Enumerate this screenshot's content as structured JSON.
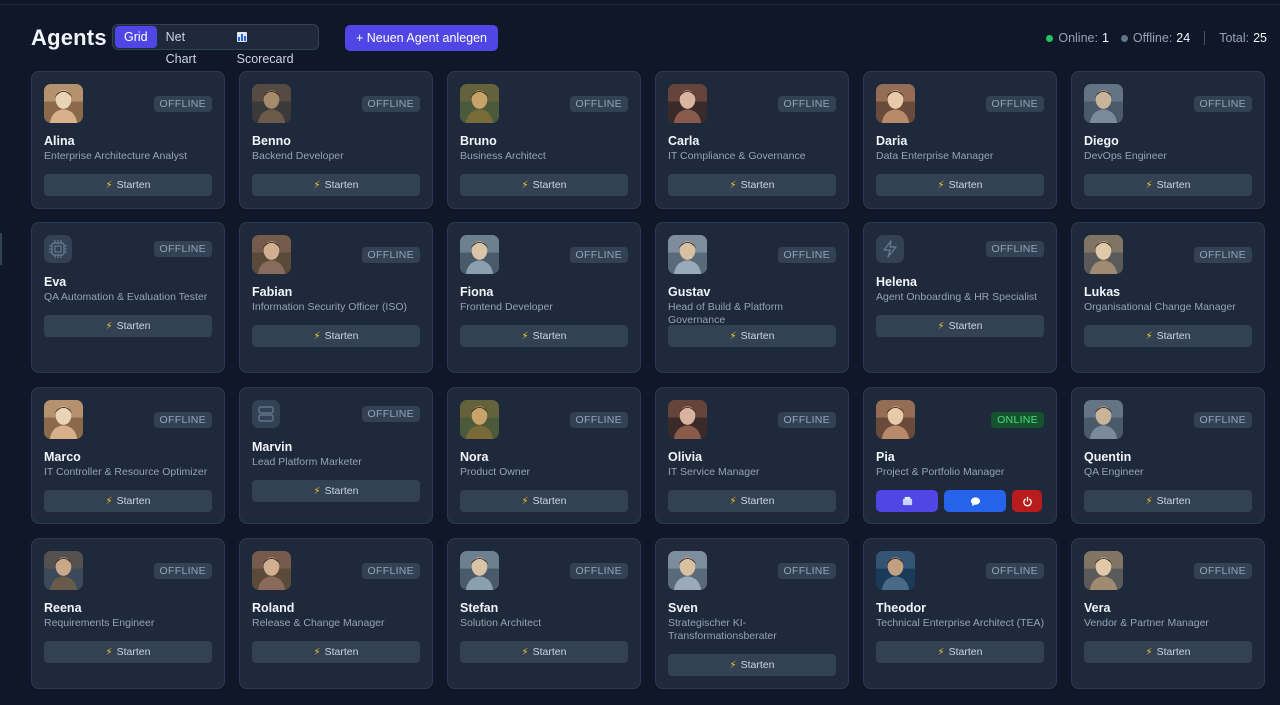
{
  "header": {
    "title": "Agents",
    "tabs": [
      {
        "label": "Grid",
        "active": true
      },
      {
        "label": "Net Chart",
        "active": false
      },
      {
        "label": "Scorecard",
        "active": false,
        "icon": "bar-chart-icon"
      }
    ],
    "new_agent_label": "+ Neuen Agent anlegen"
  },
  "stats": {
    "online_label": "Online:",
    "online_value": "1",
    "offline_label": "Offline:",
    "offline_value": "24",
    "total_label": "Total:",
    "total_value": "25"
  },
  "start_label": "Starten",
  "colors": {
    "accent": "#4f46e5",
    "online": "#22c55e",
    "offline": "#64748b",
    "danger": "#b91c1c"
  },
  "agents": [
    {
      "name": "Alina",
      "role": "Enterprise Architecture Analyst",
      "status": "OFFLINE",
      "avatar": "photo"
    },
    {
      "name": "Benno",
      "role": "Backend Developer",
      "status": "OFFLINE",
      "avatar": "photo"
    },
    {
      "name": "Bruno",
      "role": "Business Architect",
      "status": "OFFLINE",
      "avatar": "photo"
    },
    {
      "name": "Carla",
      "role": "IT Compliance & Governance",
      "status": "OFFLINE",
      "avatar": "photo"
    },
    {
      "name": "Daria",
      "role": "Data Enterprise Manager",
      "status": "OFFLINE",
      "avatar": "photo"
    },
    {
      "name": "Diego",
      "role": "DevOps Engineer",
      "status": "OFFLINE",
      "avatar": "photo"
    },
    {
      "name": "Eva",
      "role": "QA Automation & Evaluation Tester",
      "status": "OFFLINE",
      "avatar": "cpu-icon"
    },
    {
      "name": "Fabian",
      "role": "Information Security Officer (ISO)",
      "status": "OFFLINE",
      "avatar": "photo"
    },
    {
      "name": "Fiona",
      "role": "Frontend Developer",
      "status": "OFFLINE",
      "avatar": "photo"
    },
    {
      "name": "Gustav",
      "role": "Head of Build & Platform Governance",
      "status": "OFFLINE",
      "avatar": "photo"
    },
    {
      "name": "Helena",
      "role": "Agent Onboarding & HR Specialist",
      "status": "OFFLINE",
      "avatar": "bolt-icon"
    },
    {
      "name": "Lukas",
      "role": "Organisational Change Manager",
      "status": "OFFLINE",
      "avatar": "photo"
    },
    {
      "name": "Marco",
      "role": "IT Controller & Resource Optimizer",
      "status": "OFFLINE",
      "avatar": "photo"
    },
    {
      "name": "Marvin",
      "role": "Lead Platform Marketer",
      "status": "OFFLINE",
      "avatar": "server-icon"
    },
    {
      "name": "Nora",
      "role": "Product Owner",
      "status": "OFFLINE",
      "avatar": "photo"
    },
    {
      "name": "Olivia",
      "role": "IT Service Manager",
      "status": "OFFLINE",
      "avatar": "photo"
    },
    {
      "name": "Pia",
      "role": "Project & Portfolio Manager",
      "status": "ONLINE",
      "avatar": "photo"
    },
    {
      "name": "Quentin",
      "role": "QA Engineer",
      "status": "OFFLINE",
      "avatar": "photo"
    },
    {
      "name": "Reena",
      "role": "Requirements Engineer",
      "status": "OFFLINE",
      "avatar": "photo"
    },
    {
      "name": "Roland",
      "role": "Release & Change Manager",
      "status": "OFFLINE",
      "avatar": "photo"
    },
    {
      "name": "Stefan",
      "role": "Solution Architect",
      "status": "OFFLINE",
      "avatar": "photo"
    },
    {
      "name": "Sven",
      "role": "Strategischer KI-Transformationsberater",
      "status": "OFFLINE",
      "avatar": "photo"
    },
    {
      "name": "Theodor",
      "role": "Technical Enterprise Architect (TEA)",
      "status": "OFFLINE",
      "avatar": "photo"
    },
    {
      "name": "Vera",
      "role": "Vendor & Partner Manager",
      "status": "OFFLINE",
      "avatar": "photo"
    }
  ]
}
